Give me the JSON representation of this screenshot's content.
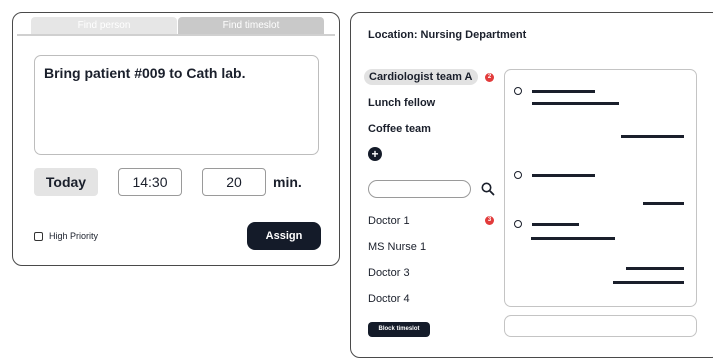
{
  "tabs": {
    "find_person": "Find person",
    "find_timeslot": "Find timeslot"
  },
  "task": {
    "text": "Bring patient #009 to Cath lab."
  },
  "time": {
    "day": "Today",
    "clock": "14:30",
    "duration": "20",
    "unit": "min."
  },
  "priority": {
    "label": "High Priority",
    "checked": false
  },
  "assign_label": "Assign",
  "location": {
    "title": "Location: Nursing Department"
  },
  "teams": [
    {
      "label": "Cardiologist team A",
      "selected": true,
      "badge": "2"
    },
    {
      "label": "Lunch fellow"
    },
    {
      "label": "Coffee team"
    }
  ],
  "add_icon": "plus-circle-icon",
  "search": {
    "placeholder": "",
    "icon": "search-icon"
  },
  "people": [
    {
      "label": "Doctor 1",
      "badge": "3"
    },
    {
      "label": "MS Nurse 1"
    },
    {
      "label": "Doctor 3"
    },
    {
      "label": "Doctor 4"
    }
  ],
  "block_label": "Block timeslot",
  "colors": {
    "dark": "#141b29",
    "badge": "#e23b3b",
    "selected_bg": "#e2e2e2"
  }
}
